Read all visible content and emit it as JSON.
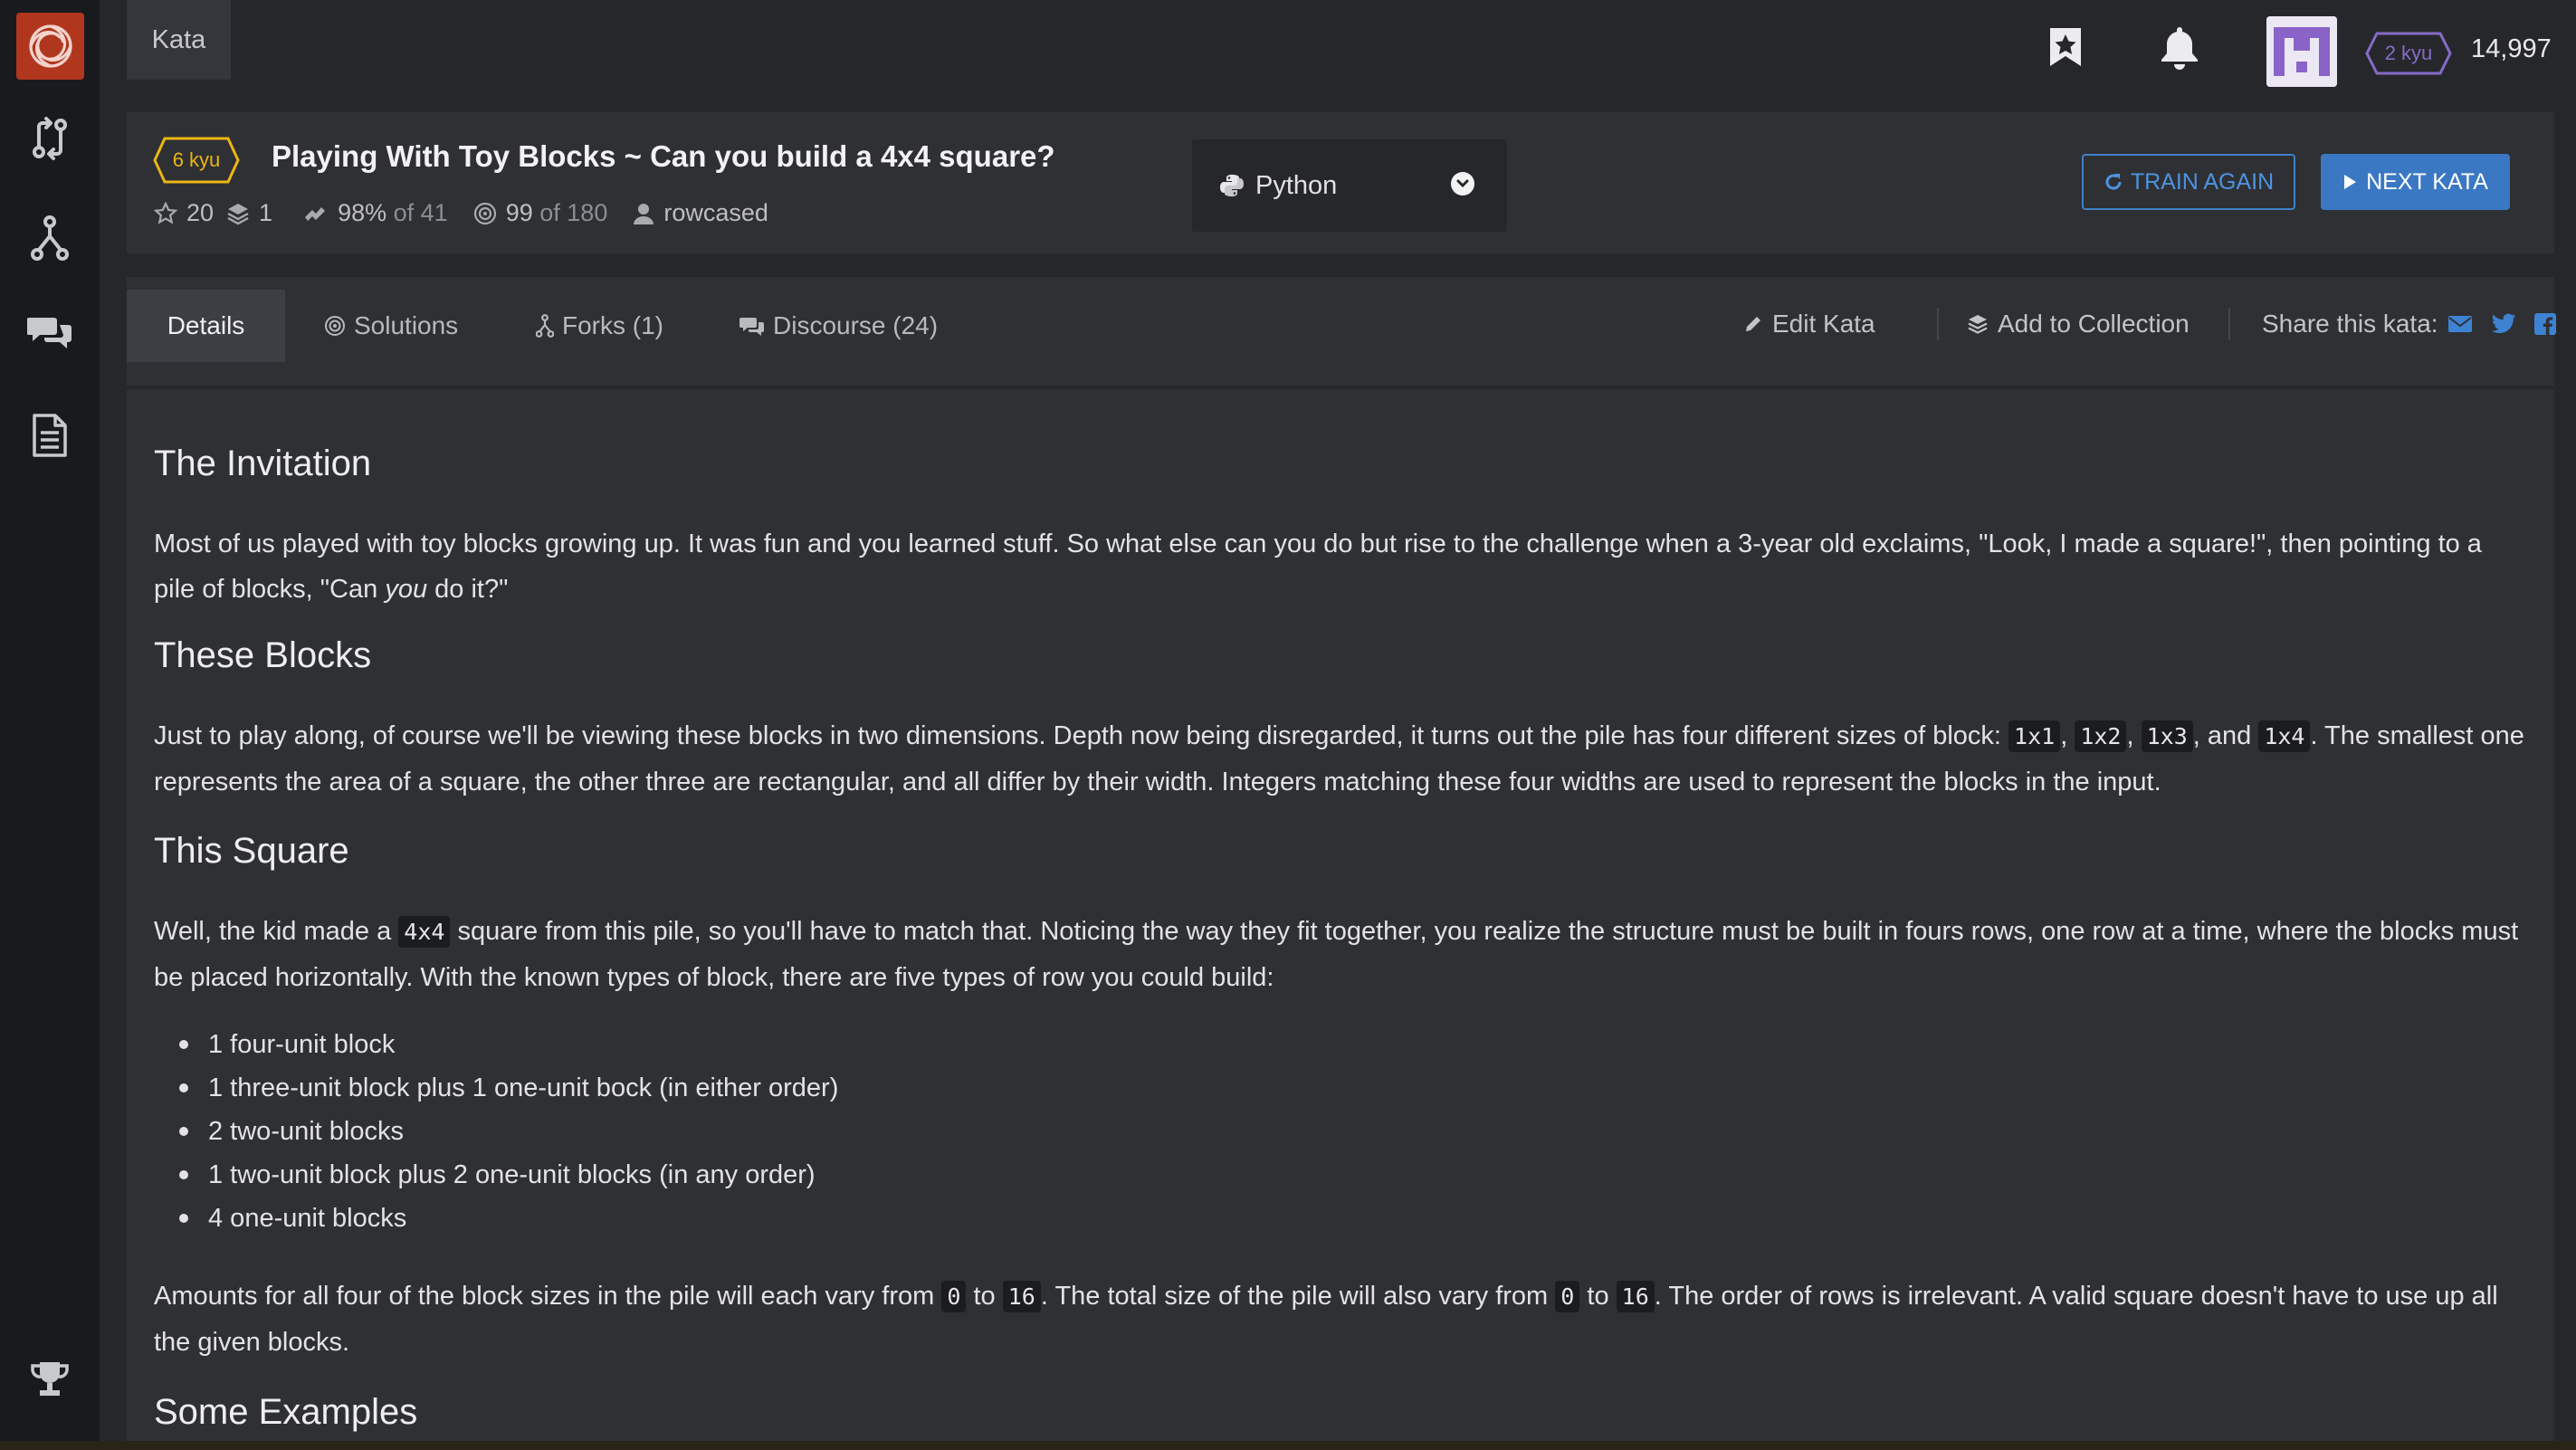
{
  "breadcrumb": {
    "label": "Kata"
  },
  "topbar": {
    "rank": "2 kyu",
    "honor": "14,997"
  },
  "kata": {
    "rank": "6 kyu",
    "title": "Playing With Toy Blocks ~ Can you build a 4x4 square?",
    "stars": "20",
    "collections": "1",
    "satisfaction": "98%",
    "satisfaction_of": "of 41",
    "completed": "99",
    "completed_of": "of 180",
    "author": "rowcased"
  },
  "language": {
    "selected": "Python"
  },
  "buttons": {
    "train_again": "TRAIN AGAIN",
    "next_kata": "NEXT KATA"
  },
  "tabs": [
    {
      "label": "Details"
    },
    {
      "label": "Solutions"
    },
    {
      "label": "Forks (1)"
    },
    {
      "label": "Discourse (24)"
    }
  ],
  "actions": {
    "edit": "Edit Kata",
    "collection": "Add to Collection",
    "share": "Share this kata:"
  },
  "description": {
    "h1": "The Invitation",
    "p1a": "Most of us played with toy blocks growing up. It was fun and you learned stuff. So what else can you do but rise to the challenge when a 3-year old exclaims, \"Look, I made a square!\", then pointing to a pile of blocks, \"Can ",
    "p1_em": "you",
    "p1b": " do it?\"",
    "h2": "These Blocks",
    "p2a": "Just to play along, of course we'll be viewing these blocks in two dimensions. Depth now being disregarded, it turns out the pile has four different sizes of block: ",
    "code_1x1": "1x1",
    "code_1x2": "1x2",
    "code_1x3": "1x3",
    "p2_and": ", and ",
    "code_1x4": "1x4",
    "p2b": ". The smallest one represents the area of a square, the other three are rectangular, and all differ by their width. Integers matching these four widths are used to represent the blocks in the input.",
    "h3": "This Square",
    "p3a": "Well, the kid made a ",
    "code_4x4": "4x4",
    "p3b": " square from this pile, so you'll have to match that. Noticing the way they fit together, you realize the structure must be built in fours rows, one row at a time, where the blocks must be placed horizontally. With the known types of block, there are five types of row you could build:",
    "rows": [
      "1 four-unit block",
      "1 three-unit block plus 1 one-unit bock (in either order)",
      "2 two-unit blocks",
      "1 two-unit block plus 2 one-unit blocks (in any order)",
      "4 one-unit blocks"
    ],
    "p4a": "Amounts for all four of the block sizes in the pile will each vary from ",
    "code_0": "0",
    "p4_to": " to ",
    "code_16": "16",
    "p4b": ". The total size of the pile will also vary from ",
    "p4c": ". The order of rows is irrelevant. A valid square doesn't have to use up all the given blocks.",
    "h4": "Some Examples"
  }
}
